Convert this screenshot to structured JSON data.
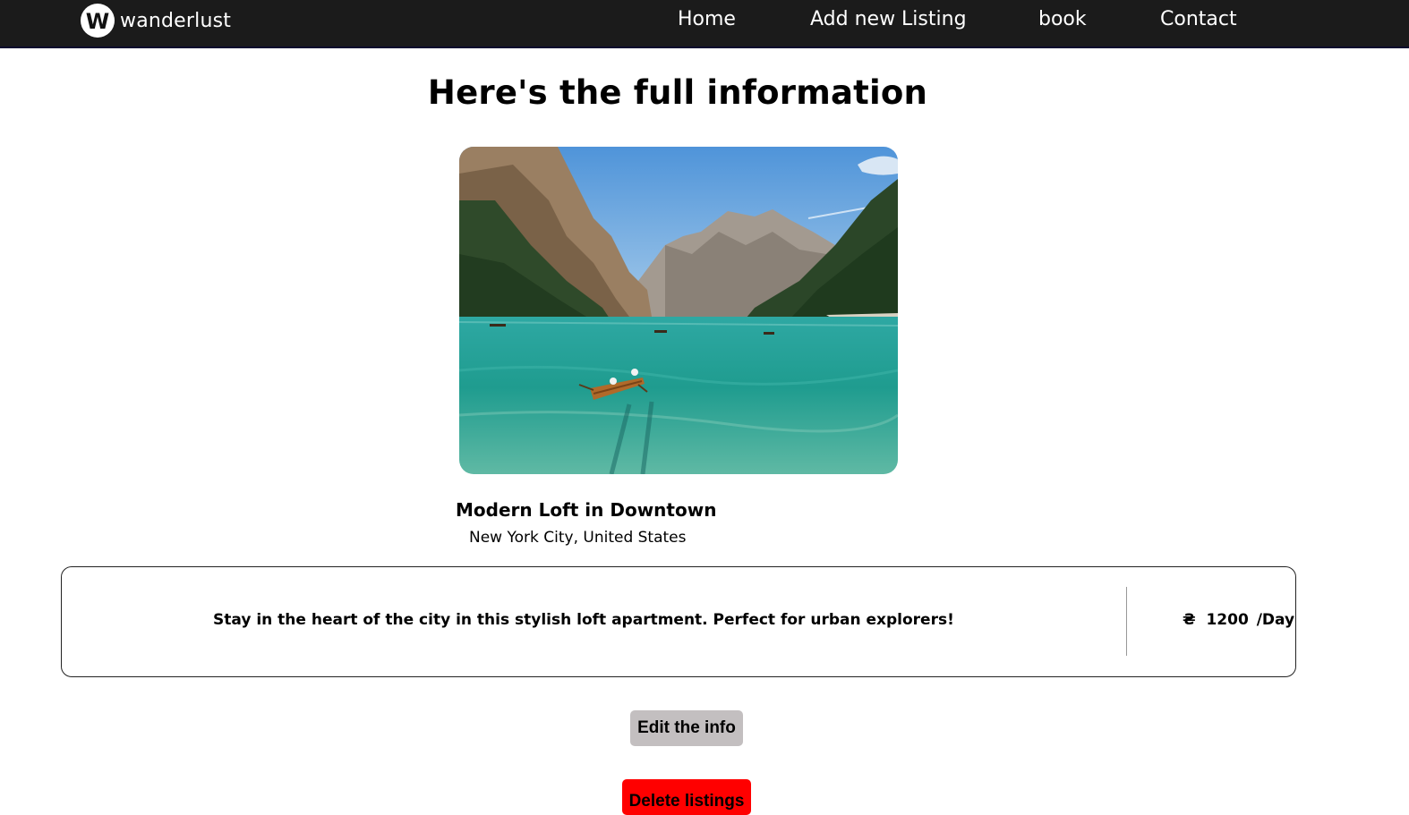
{
  "navbar": {
    "logo_letter": "W",
    "brand": "wanderlust",
    "links": [
      {
        "label": "Home"
      },
      {
        "label": "Add new Listing"
      },
      {
        "label": "book"
      },
      {
        "label": "Contact"
      }
    ]
  },
  "page": {
    "title": "Here's the full information"
  },
  "listing": {
    "image_description_icon": "landscape-photo",
    "title": "Modern Loft in Downtown",
    "location": "New York City, United States",
    "description": "Stay in the heart of the city in this stylish loft apartment. Perfect for urban explorers!",
    "currency_symbol": "₴",
    "price": "1200",
    "price_unit": "/Day"
  },
  "actions": {
    "edit_label": "Edit the info",
    "delete_label": "Delete listings"
  },
  "colors": {
    "navbar_bg": "#1b1b1b",
    "edit_button_bg": "#c3bfc0",
    "delete_button_bg": "#ff0000"
  }
}
